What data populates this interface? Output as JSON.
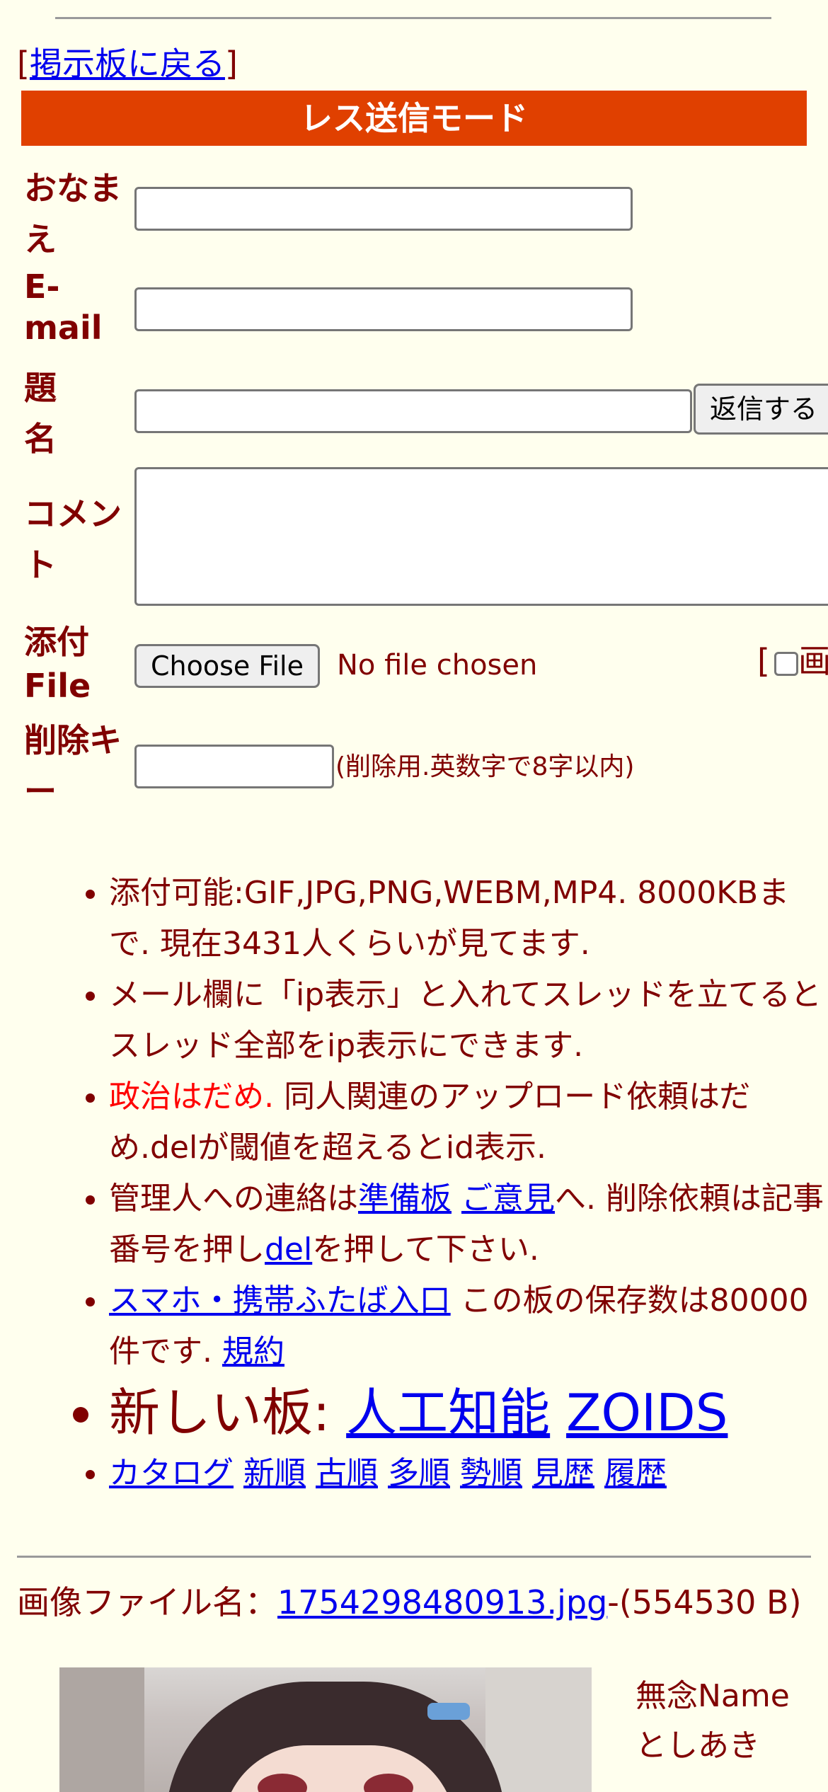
{
  "nav": {
    "bracket_open": "[",
    "back_link": "掲示板に戻る",
    "bracket_close": "]"
  },
  "form": {
    "title": "レス送信モード",
    "name_label": "おなまえ",
    "email_label": "E-mail",
    "subject_label": "題名",
    "submit_label": "返信する",
    "comment_label": "コメント",
    "file_label": "添付File",
    "choose_file_label": "Choose File",
    "no_file_text": "No file chosen",
    "image_option_prefix": "[",
    "image_option_label": "画",
    "delkey_label": "削除キー",
    "delkey_note": "(削除用.英数字で8字以内)"
  },
  "rules": {
    "r1": "添付可能:GIF,JPG,PNG,WEBM,MP4. 8000KBまで. 現在3431人くらいが見てます.",
    "r2": "メール欄に「ip表示」と入れてスレッドを立てるとスレッド全部をip表示にできます.",
    "r3_red": "政治はだめ.",
    "r3_rest": " 同人関連のアップロード依頼はだめ.delが閾値を超えるとid表示.",
    "r4_pre": "管理人への連絡は",
    "r4_link1": "準備板",
    "r4_link2": "ご意見",
    "r4_mid": "へ. 削除依頼は記事番号を押し",
    "r4_link3": "del",
    "r4_post": "を押して下さい.",
    "r5_link": "スマホ・携帯ふたば入口",
    "r5_mid": " この板の保存数は80000件です. ",
    "r5_link2": "規約",
    "r6_prefix": "新しい板: ",
    "r6_link1": "人工知能",
    "r6_link2": "ZOIDS",
    "links": [
      "カタログ",
      "新順",
      "古順",
      "多順",
      "勢順",
      "見歴",
      "履歴"
    ]
  },
  "post": {
    "file_prefix": "画像ファイル名：",
    "file_link": "1754298480913.jpg",
    "file_size": "-(554530 B)",
    "name": "無念Name",
    "author": "としあき"
  }
}
